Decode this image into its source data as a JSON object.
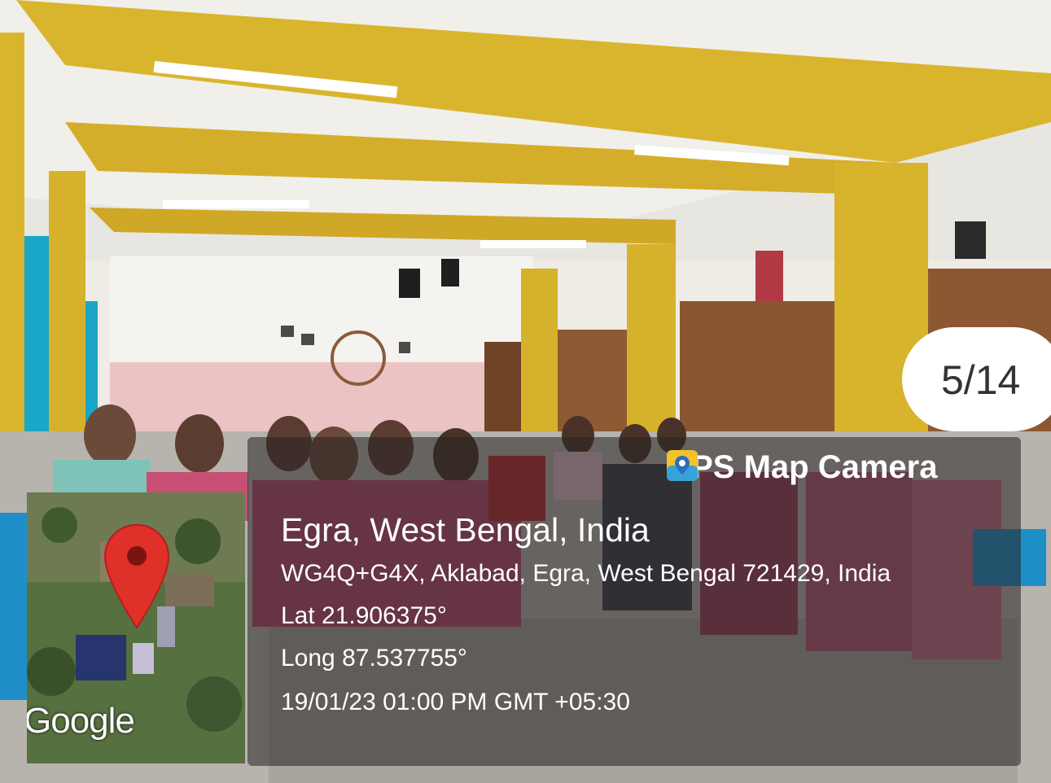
{
  "photo": {
    "counter": "5/14",
    "stamp": {
      "brand_icon": "map-pin-icon",
      "brand": "GPS Map Camera",
      "place": "Egra, West Bengal, India",
      "address": "WG4Q+G4X, Aklabad, Egra, West Bengal 721429, India",
      "latitude": "Lat 21.906375°",
      "longitude": "Long 87.537755°",
      "datetime": "19/01/23 01:00 PM GMT +05:30"
    },
    "map": {
      "marker_icon": "red-map-pin-icon",
      "logo": "Google"
    }
  }
}
